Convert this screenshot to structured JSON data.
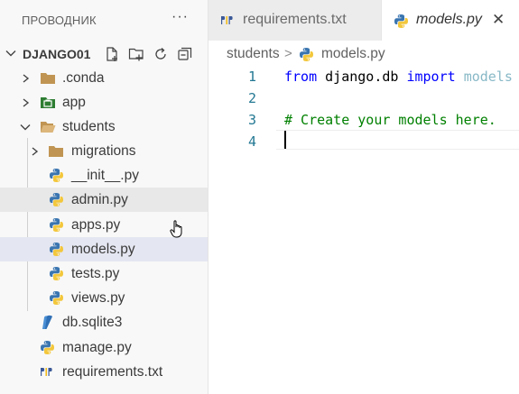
{
  "explorer": {
    "title": "ПРОВОДНИК",
    "more": "···",
    "project": "DJANGO01",
    "actions": [
      "new-file-icon",
      "new-folder-icon",
      "refresh-icon",
      "collapse-all-icon"
    ],
    "items": [
      {
        "label": ".conda"
      },
      {
        "label": "app"
      },
      {
        "label": "students"
      },
      {
        "label": "migrations"
      },
      {
        "label": "__init__.py"
      },
      {
        "label": "admin.py"
      },
      {
        "label": "apps.py"
      },
      {
        "label": "models.py"
      },
      {
        "label": "tests.py"
      },
      {
        "label": "views.py"
      },
      {
        "label": "db.sqlite3"
      },
      {
        "label": "manage.py"
      },
      {
        "label": "requirements.txt"
      }
    ]
  },
  "tabs": [
    {
      "label": "requirements.txt",
      "icon": "pip-icon",
      "active": false
    },
    {
      "label": "models.py",
      "icon": "python-icon",
      "active": true,
      "close": "✕"
    }
  ],
  "breadcrumb": {
    "folder": "students",
    "separator": ">",
    "file": "models.py"
  },
  "editor": {
    "line_numbers": [
      "1",
      "2",
      "3",
      "4"
    ],
    "line1": {
      "kw1": "from",
      "module": "django.db",
      "kw2": "import",
      "rest": "models"
    },
    "line3": "# Create your models here."
  },
  "colors": {
    "keyword": "#0000ff",
    "comment": "#008000",
    "line_number": "#237893",
    "selected_row": "#e4e6f1",
    "hover_row": "#e8e8e8",
    "sidebar_bg": "#f8f8f8"
  }
}
